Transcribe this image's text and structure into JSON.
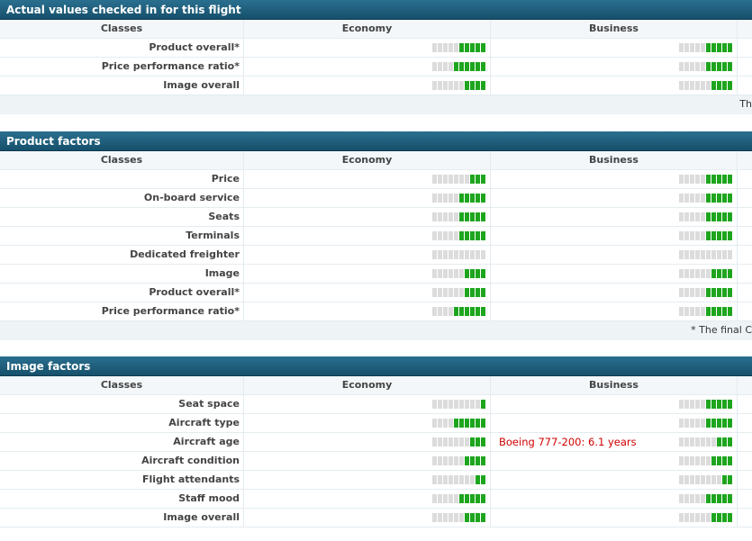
{
  "sections": [
    {
      "title": "Actual values checked in for this flight",
      "headers": {
        "classes": "Classes",
        "economy": "Economy",
        "business": "Business"
      },
      "rows": [
        {
          "label": "Product overall*",
          "economy": 5,
          "business": 5
        },
        {
          "label": "Price performance ratio*",
          "economy": 6,
          "business": 5
        },
        {
          "label": "Image overall",
          "economy": 4,
          "business": 4
        }
      ],
      "footer": "Th"
    },
    {
      "title": "Product factors",
      "headers": {
        "classes": "Classes",
        "economy": "Economy",
        "business": "Business"
      },
      "rows": [
        {
          "label": "Price",
          "economy": 3,
          "business": 5
        },
        {
          "label": "On-board service",
          "economy": 5,
          "business": 5
        },
        {
          "label": "Seats",
          "economy": 5,
          "business": 5
        },
        {
          "label": "Terminals",
          "economy": 5,
          "business": 5
        },
        {
          "label": "Dedicated freighter",
          "economy": 0,
          "business": 0
        },
        {
          "label": "Image",
          "economy": 4,
          "business": 4
        },
        {
          "label": "Product overall*",
          "economy": 4,
          "business": 5
        },
        {
          "label": "Price performance ratio*",
          "economy": 6,
          "business": 5
        }
      ],
      "footer": "* The final C"
    },
    {
      "title": "Image factors",
      "headers": {
        "classes": "Classes",
        "economy": "Economy",
        "business": "Business"
      },
      "rows": [
        {
          "label": "Seat space",
          "economy": 1,
          "business": 5
        },
        {
          "label": "Aircraft type",
          "economy": 6,
          "business": 5
        },
        {
          "label": "Aircraft age",
          "economy": 3,
          "business": 3,
          "note": "Boeing 777-200: 6.1 years"
        },
        {
          "label": "Aircraft condition",
          "economy": 4,
          "business": 4
        },
        {
          "label": "Flight attendants",
          "economy": 2,
          "business": 2
        },
        {
          "label": "Staff mood",
          "economy": 5,
          "business": 5
        },
        {
          "label": "Image overall",
          "economy": 4,
          "business": 4
        }
      ]
    }
  ],
  "meter_max": 10,
  "colors": {
    "on": "#1ea51e",
    "off": "#dcdcdc",
    "header": "#1f6080",
    "note": "#d00000"
  }
}
